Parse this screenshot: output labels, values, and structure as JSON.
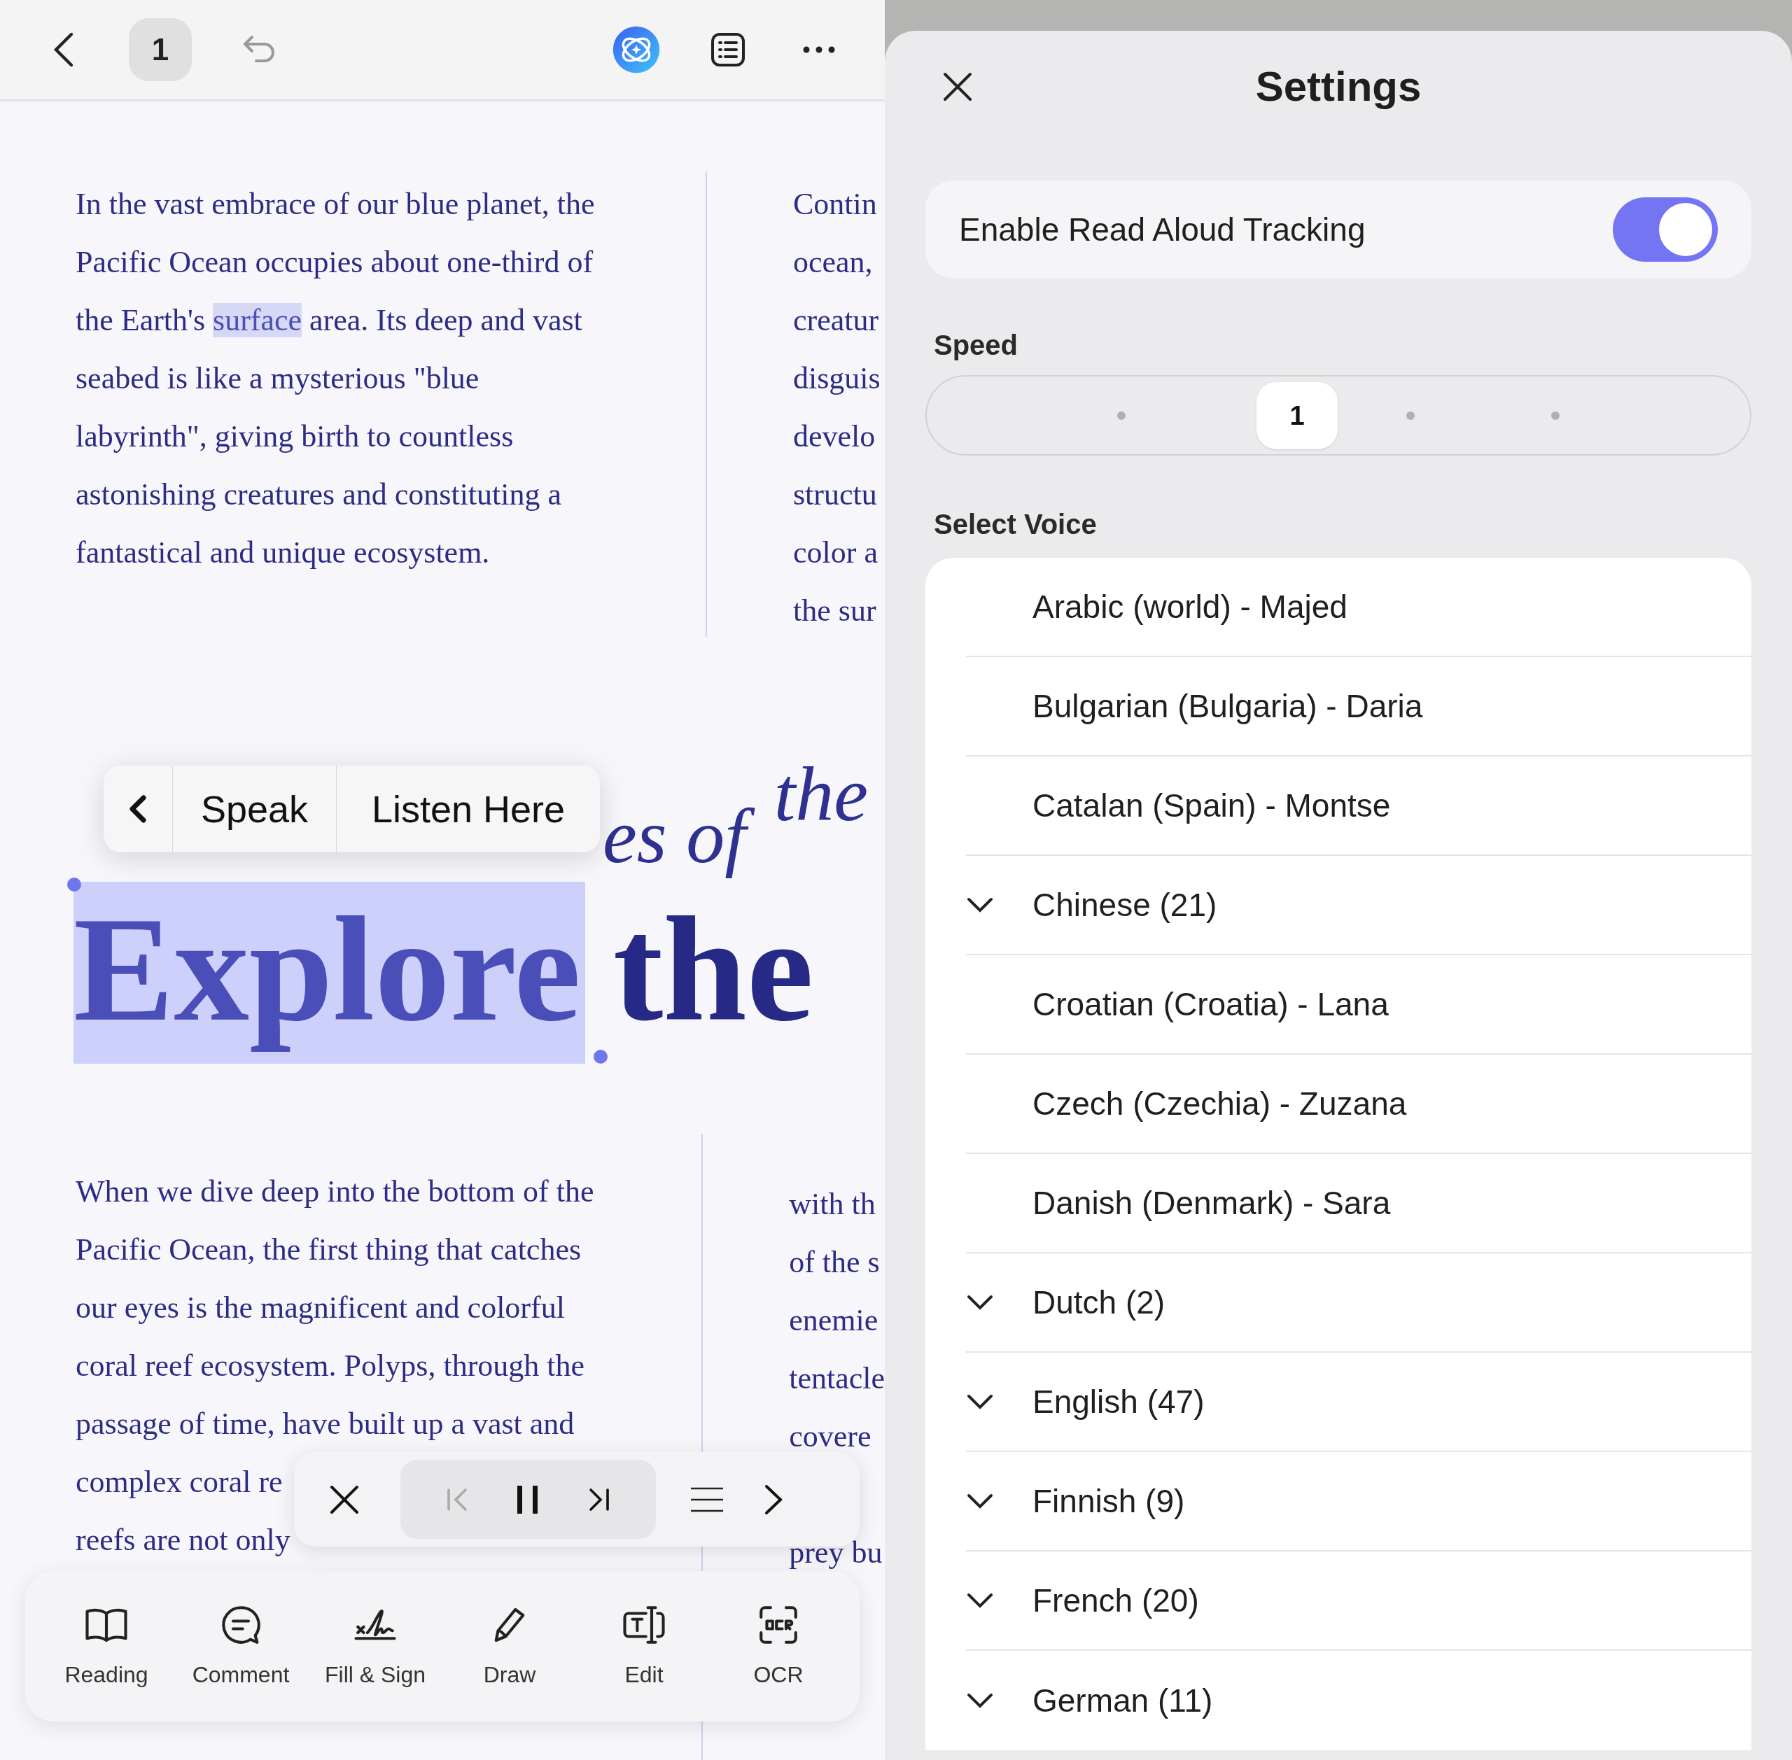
{
  "top_bar": {
    "page": "1"
  },
  "document": {
    "column_1_top": [
      [
        {
          "text": "In the vast embrace of our blue planet, the",
          "highlighted": false
        }
      ],
      [
        {
          "text": "Pacific Ocean occupies about one-third of",
          "highlighted": false
        }
      ],
      [
        {
          "text": "the Earth's ",
          "highlighted": false
        },
        {
          "text": "surface",
          "highlighted": true
        },
        {
          "text": " area. Its deep and vast",
          "highlighted": false
        }
      ],
      [
        {
          "text": "seabed is like a mysterious \"blue",
          "highlighted": false
        }
      ],
      [
        {
          "text": "labyrinth\", giving birth to countless",
          "highlighted": false
        }
      ],
      [
        {
          "text": "astonishing creatures and constituting a",
          "highlighted": false
        }
      ],
      [
        {
          "text": "fantastical and unique ecosystem.",
          "highlighted": false
        }
      ]
    ],
    "column_2_top": [
      "Contin",
      "ocean,",
      "creatur",
      "disguis",
      "develo",
      "structu",
      "color a",
      "the sur"
    ],
    "subtitle_fragments": [
      "es of",
      "the"
    ],
    "title": [
      {
        "text": "Explore",
        "selected": true
      },
      {
        "text": "the",
        "selected": false
      }
    ],
    "column_1_bottom": [
      "When we dive deep into the bottom of the",
      "Pacific Ocean, the first thing that catches",
      "our eyes is the magnificent and colorful",
      "coral reef ecosystem. Polyps, through the",
      "passage of time, have built up a vast and",
      "complex coral re",
      "reefs are not only"
    ],
    "column_2_bottom": [
      "with th",
      "of the s",
      "enemie",
      "tentacle",
      "covere"
    ],
    "column_2_after_player": [
      "prey bu"
    ]
  },
  "selection_menu": {
    "items": [
      "Speak",
      "Listen Here"
    ]
  },
  "player": {
    "playing": true,
    "previous_disabled": true
  },
  "toolbar": [
    {
      "label": "Reading"
    },
    {
      "label": "Comment"
    },
    {
      "label": "Fill & Sign"
    },
    {
      "label": "Draw"
    },
    {
      "label": "Edit"
    },
    {
      "label": "OCR"
    }
  ],
  "settings": {
    "title": "Settings",
    "tracking": {
      "label": "Enable Read Aloud Tracking",
      "on": true
    },
    "speed": {
      "label": "Speed",
      "value": "1",
      "level": 0.45
    },
    "voice_label": "Select Voice",
    "voices": [
      {
        "kind": "voice",
        "label": "Arabic (world) - Majed"
      },
      {
        "kind": "voice",
        "label": "Bulgarian (Bulgaria) - Daria"
      },
      {
        "kind": "voice",
        "label": "Catalan (Spain) - Montse"
      },
      {
        "kind": "group",
        "label": "Chinese (21)",
        "expanded": false
      },
      {
        "kind": "voice",
        "label": "Croatian (Croatia) - Lana"
      },
      {
        "kind": "voice",
        "label": "Czech (Czechia) - Zuzana"
      },
      {
        "kind": "voice",
        "label": "Danish (Denmark) - Sara"
      },
      {
        "kind": "group",
        "label": "Dutch (2)",
        "expanded": false
      },
      {
        "kind": "group",
        "label": "English (47)",
        "expanded": false
      },
      {
        "kind": "group",
        "label": "Finnish (9)",
        "expanded": false
      },
      {
        "kind": "group",
        "label": "French (20)",
        "expanded": false
      },
      {
        "kind": "group",
        "label": "German (11)",
        "expanded": false
      }
    ]
  }
}
